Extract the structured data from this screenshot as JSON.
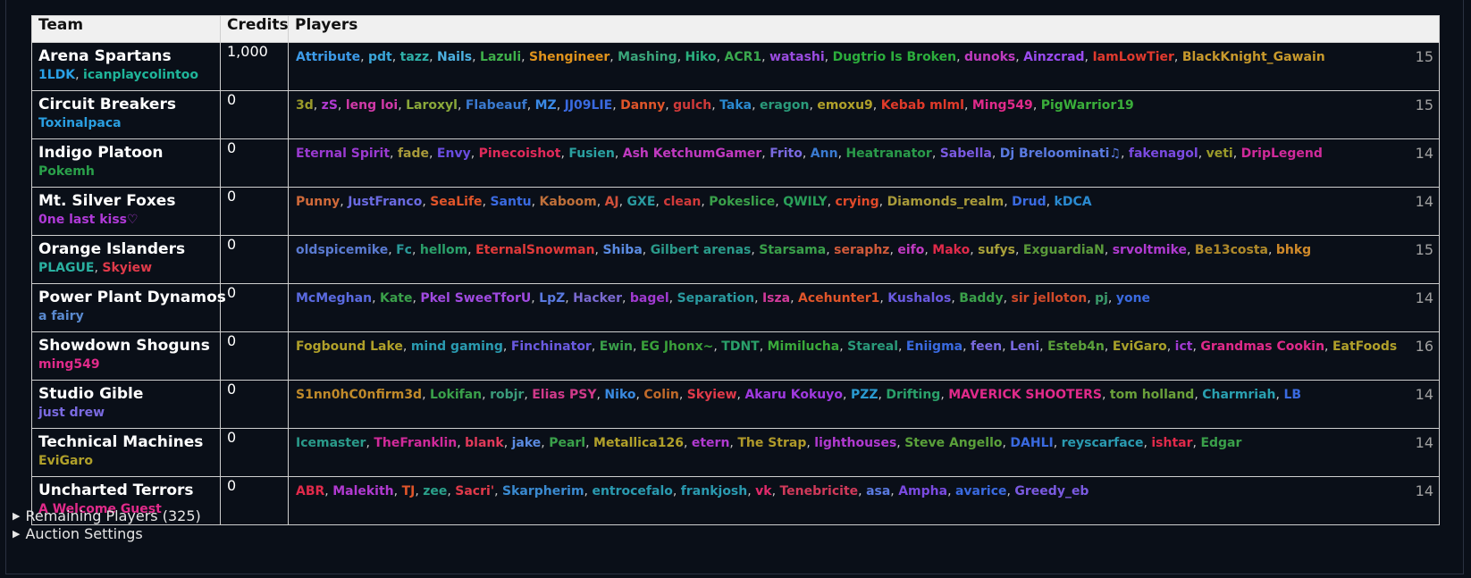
{
  "headers": {
    "team": "Team",
    "credits": "Credits",
    "players": "Players"
  },
  "teams": [
    {
      "name": "Arena Spartans",
      "managers": [
        {
          "name": "1LDK",
          "color": "#2aa0e6"
        },
        {
          "name": "icanplaycolintoo",
          "color": "#1fb59a"
        }
      ],
      "credits": "1,000",
      "count": "15",
      "players": [
        {
          "name": "Attribute",
          "color": "#3d9be9"
        },
        {
          "name": "pdt",
          "color": "#3aa6d8"
        },
        {
          "name": "tazz",
          "color": "#2fb0a8"
        },
        {
          "name": "Nails",
          "color": "#4cb0e0"
        },
        {
          "name": "Lazuli",
          "color": "#3fb04a"
        },
        {
          "name": "Shengineer",
          "color": "#e0931c"
        },
        {
          "name": "Mashing",
          "color": "#3aa57a"
        },
        {
          "name": "Hiko",
          "color": "#2ab07e"
        },
        {
          "name": "ACR1",
          "color": "#3aa84e"
        },
        {
          "name": "watashi",
          "color": "#9a4ce0"
        },
        {
          "name": "Dugtrio Is Broken",
          "color": "#2cae3c"
        },
        {
          "name": "dunoks",
          "color": "#c03cc0"
        },
        {
          "name": "Ainzcrad",
          "color": "#9a4cf0"
        },
        {
          "name": "IamLowTier",
          "color": "#e03a2e"
        },
        {
          "name": "BlackKnight_Gawain",
          "color": "#c89a2c"
        }
      ]
    },
    {
      "name": "Circuit Breakers",
      "managers": [
        {
          "name": "Toxinalpaca",
          "color": "#2a9ee0"
        }
      ],
      "credits": "0",
      "count": "15",
      "players": [
        {
          "name": "3d",
          "color": "#9a9a2a"
        },
        {
          "name": "zS",
          "color": "#b03ad0"
        },
        {
          "name": "leng loi",
          "color": "#d03aa8"
        },
        {
          "name": "Laroxyl",
          "color": "#8aa83a"
        },
        {
          "name": "Flabeauf",
          "color": "#3a7ad0"
        },
        {
          "name": "MZ",
          "color": "#3a8ae6"
        },
        {
          "name": "JJ09LIE",
          "color": "#3a6ae0"
        },
        {
          "name": "Danny",
          "color": "#e0552a"
        },
        {
          "name": "gulch",
          "color": "#d03a3a"
        },
        {
          "name": "Taka",
          "color": "#2a8ad0"
        },
        {
          "name": "eragon",
          "color": "#2a9a7a"
        },
        {
          "name": "emoxu9",
          "color": "#b0a02a"
        },
        {
          "name": "Kebab mlml",
          "color": "#e03a2a"
        },
        {
          "name": "Ming549",
          "color": "#e02a8a"
        },
        {
          "name": "PigWarrior19",
          "color": "#3aae3a"
        }
      ]
    },
    {
      "name": "Indigo Platoon",
      "managers": [
        {
          "name": "Pokemh",
          "color": "#2aa04a"
        }
      ],
      "credits": "0",
      "count": "14",
      "players": [
        {
          "name": "Eternal Spirit",
          "color": "#9a3ad0"
        },
        {
          "name": "fade",
          "color": "#a89a3a"
        },
        {
          "name": "Envy",
          "color": "#6a4ce0"
        },
        {
          "name": "Pinecoishot",
          "color": "#e02a5a"
        },
        {
          "name": "Fusien",
          "color": "#2aa0a0"
        },
        {
          "name": "Ash KetchumGamer",
          "color": "#c03ac0"
        },
        {
          "name": "Frito",
          "color": "#7a6ae0"
        },
        {
          "name": "Ann",
          "color": "#3a7ad0"
        },
        {
          "name": "Heatranator",
          "color": "#2a9a4a"
        },
        {
          "name": "Sabella",
          "color": "#7a5ae0"
        },
        {
          "name": "Dj Breloominati♫",
          "color": "#5a7ae0"
        },
        {
          "name": "fakenagol",
          "color": "#7a4ae0"
        },
        {
          "name": "veti",
          "color": "#9a9a2a"
        },
        {
          "name": "DripLegend",
          "color": "#d02a9a"
        }
      ]
    },
    {
      "name": "Mt. Silver Foxes",
      "managers": [
        {
          "name": "0ne last kiss♡",
          "color": "#b03ad8"
        }
      ],
      "credits": "0",
      "count": "14",
      "players": [
        {
          "name": "Punny",
          "color": "#d06a3a"
        },
        {
          "name": "JustFranco",
          "color": "#6a6ae0"
        },
        {
          "name": "SeaLife",
          "color": "#e0552a"
        },
        {
          "name": "Santu",
          "color": "#3a6ae0"
        },
        {
          "name": "Kaboom",
          "color": "#c0703a"
        },
        {
          "name": "AJ",
          "color": "#d0503a"
        },
        {
          "name": "GXE",
          "color": "#2a9aa0"
        },
        {
          "name": "clean",
          "color": "#d03a3a"
        },
        {
          "name": "Pokeslice",
          "color": "#3aa04a"
        },
        {
          "name": "QWILY",
          "color": "#2aa05a"
        },
        {
          "name": "crying",
          "color": "#e04a2a"
        },
        {
          "name": "Diamonds_realm",
          "color": "#a89a3a"
        },
        {
          "name": "Drud",
          "color": "#3a6ae0"
        },
        {
          "name": "kDCA",
          "color": "#2a8ad0"
        }
      ]
    },
    {
      "name": "Orange Islanders",
      "managers": [
        {
          "name": "PLAGUE",
          "color": "#2ab0a0"
        },
        {
          "name": "Skyiew",
          "color": "#e03a4a"
        }
      ],
      "credits": "0",
      "count": "15",
      "players": [
        {
          "name": "oldspicemike",
          "color": "#5a7ad0"
        },
        {
          "name": "Fc",
          "color": "#2a9a9a"
        },
        {
          "name": "hellom",
          "color": "#2aa06a"
        },
        {
          "name": "EternalSnowman",
          "color": "#e03a3a"
        },
        {
          "name": "Shiba",
          "color": "#5a8ae0"
        },
        {
          "name": "Gilbert arenas",
          "color": "#2a9a8a"
        },
        {
          "name": "Starsama",
          "color": "#3aa04a"
        },
        {
          "name": "seraphz",
          "color": "#d05a3a"
        },
        {
          "name": "eifo",
          "color": "#c03ac0"
        },
        {
          "name": "Mako",
          "color": "#e02a4a"
        },
        {
          "name": "sufys",
          "color": "#a8a03a"
        },
        {
          "name": "ExguardiaN",
          "color": "#5a9a3a"
        },
        {
          "name": "srvoltmike",
          "color": "#b03ad0"
        },
        {
          "name": "Be13costa",
          "color": "#b08a2a"
        },
        {
          "name": "bhkg",
          "color": "#d08a2a"
        }
      ]
    },
    {
      "name": "Power Plant Dynamos",
      "managers": [
        {
          "name": "a fairy",
          "color": "#5a8ad0"
        }
      ],
      "credits": "0",
      "count": "14",
      "players": [
        {
          "name": "McMeghan",
          "color": "#5a6ae0"
        },
        {
          "name": "Kate",
          "color": "#3aa04a"
        },
        {
          "name": "Pkel SweeTforU",
          "color": "#a04ae0"
        },
        {
          "name": "LpZ",
          "color": "#5a7ae0"
        },
        {
          "name": "Hacker",
          "color": "#7a6ad0"
        },
        {
          "name": "bagel",
          "color": "#a03ad0"
        },
        {
          "name": "Separation",
          "color": "#2a9aa0"
        },
        {
          "name": "Isza",
          "color": "#d03a9a"
        },
        {
          "name": "Acehunter1",
          "color": "#e0552a"
        },
        {
          "name": "Kushalos",
          "color": "#6a5ae0"
        },
        {
          "name": "Baddy",
          "color": "#3aa04a"
        },
        {
          "name": "sir jelloton",
          "color": "#d04a2a"
        },
        {
          "name": "pj",
          "color": "#3a9a6a"
        },
        {
          "name": "yone",
          "color": "#3a6ae0"
        }
      ]
    },
    {
      "name": "Showdown Shoguns",
      "managers": [
        {
          "name": "ming549",
          "color": "#e02a8a"
        }
      ],
      "credits": "0",
      "count": "16",
      "players": [
        {
          "name": "Fogbound Lake",
          "color": "#b0a02a"
        },
        {
          "name": "mind gaming",
          "color": "#2a9ab0"
        },
        {
          "name": "Finchinator",
          "color": "#6a5ae0"
        },
        {
          "name": "Ewin",
          "color": "#3aa04a"
        },
        {
          "name": "EG Jhonx~",
          "color": "#3aa03a"
        },
        {
          "name": "TDNT",
          "color": "#2aa06a"
        },
        {
          "name": "Mimilucha",
          "color": "#3aa83a"
        },
        {
          "name": "Stareal",
          "color": "#2a9a7a"
        },
        {
          "name": "Eniigma",
          "color": "#3a6ae0"
        },
        {
          "name": "feen",
          "color": "#7a6ae0"
        },
        {
          "name": "Leni",
          "color": "#7a6ae0"
        },
        {
          "name": "Esteb4n",
          "color": "#5aa03a"
        },
        {
          "name": "EviGaro",
          "color": "#a8a02a"
        },
        {
          "name": "ict",
          "color": "#a03ad0"
        },
        {
          "name": "Grandmas Cookin",
          "color": "#e02a8a"
        },
        {
          "name": "EatFoods",
          "color": "#b0a02a"
        }
      ]
    },
    {
      "name": "Studio Gible",
      "managers": [
        {
          "name": "just drew",
          "color": "#7a6ae0"
        }
      ],
      "credits": "0",
      "count": "14",
      "players": [
        {
          "name": "S1nn0hC0nfirm3d",
          "color": "#c08a2a"
        },
        {
          "name": "Lokifan",
          "color": "#3aa04a"
        },
        {
          "name": "robjr",
          "color": "#3a9a7a"
        },
        {
          "name": "Elias PSY",
          "color": "#d03a8a"
        },
        {
          "name": "Niko",
          "color": "#3a8ae0"
        },
        {
          "name": "Colin",
          "color": "#c06a2a"
        },
        {
          "name": "Skyiew",
          "color": "#e03a4a"
        },
        {
          "name": "Akaru Kokuyo",
          "color": "#a03ae0"
        },
        {
          "name": "PZZ",
          "color": "#2a9ad0"
        },
        {
          "name": "Drifting",
          "color": "#2aa06a"
        },
        {
          "name": "MAVERICK SHOOTERS",
          "color": "#e02a8a"
        },
        {
          "name": "tom holland",
          "color": "#6aa03a"
        },
        {
          "name": "Charmriah",
          "color": "#2aa0b0"
        },
        {
          "name": "LB",
          "color": "#3a6ae0"
        }
      ]
    },
    {
      "name": "Technical Machines",
      "managers": [
        {
          "name": "EviGaro",
          "color": "#b0a02a"
        }
      ],
      "credits": "0",
      "count": "14",
      "players": [
        {
          "name": "Icemaster",
          "color": "#2a9a8a"
        },
        {
          "name": "TheFranklin",
          "color": "#d02a9a"
        },
        {
          "name": "blank",
          "color": "#e03a5a"
        },
        {
          "name": "jake",
          "color": "#5a8ae0"
        },
        {
          "name": "Pearl",
          "color": "#3aa04a"
        },
        {
          "name": "Metallica126",
          "color": "#b0a02a"
        },
        {
          "name": "etern",
          "color": "#b03ad0"
        },
        {
          "name": "The Strap",
          "color": "#b09a2a"
        },
        {
          "name": "lighthouses",
          "color": "#b03ad0"
        },
        {
          "name": "Steve Angello",
          "color": "#5aa03a"
        },
        {
          "name": "DAHLI",
          "color": "#3a6ae0"
        },
        {
          "name": "reyscarface",
          "color": "#2a9ab0"
        },
        {
          "name": "ishtar",
          "color": "#e02a4a"
        },
        {
          "name": "Edgar",
          "color": "#3aa04a"
        }
      ]
    },
    {
      "name": "Uncharted Terrors",
      "managers": [
        {
          "name": "A Welcome Guest",
          "color": "#e02a8a"
        }
      ],
      "credits": "0",
      "count": "14",
      "players": [
        {
          "name": "ABR",
          "color": "#e02a4a"
        },
        {
          "name": "Malekith",
          "color": "#b03ad0"
        },
        {
          "name": "TJ",
          "color": "#e0552a"
        },
        {
          "name": "zee",
          "color": "#2aa08a"
        },
        {
          "name": "Sacri'",
          "color": "#e03a4a"
        },
        {
          "name": "Skarpherim",
          "color": "#3a8ad0"
        },
        {
          "name": "entrocefalo",
          "color": "#2a9ab0"
        },
        {
          "name": "frankjosh",
          "color": "#2a9ab0"
        },
        {
          "name": "vk",
          "color": "#e02a6a"
        },
        {
          "name": "Tenebricite",
          "color": "#d03a5a"
        },
        {
          "name": "asa",
          "color": "#5a7ae0"
        },
        {
          "name": "Ampha",
          "color": "#7a4ae0"
        },
        {
          "name": "avarice",
          "color": "#3a6ae0"
        },
        {
          "name": "Greedy_eb",
          "color": "#7a5ae0"
        }
      ]
    }
  ],
  "sections": [
    {
      "name": "remaining-players",
      "label": "Remaining Players (325)"
    },
    {
      "name": "auction-settings",
      "label": "Auction Settings"
    }
  ]
}
